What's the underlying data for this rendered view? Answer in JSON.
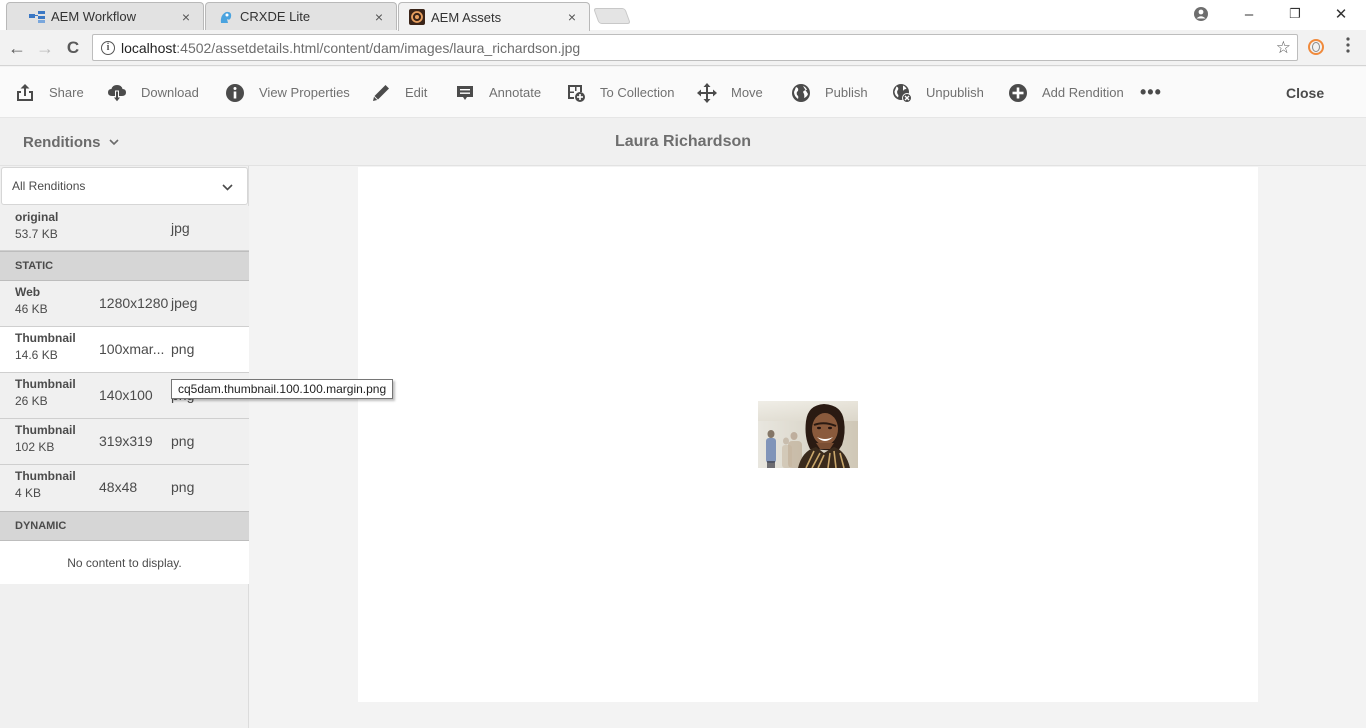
{
  "browser": {
    "tabs": [
      {
        "title": "AEM Workflow",
        "icon": "workflow-icon",
        "active": false
      },
      {
        "title": "CRXDE Lite",
        "icon": "crxde-icon",
        "active": false
      },
      {
        "title": "AEM Assets",
        "icon": "aem-icon",
        "active": true
      }
    ],
    "close_glyph": "×",
    "window_controls": {
      "profile": "profile-icon",
      "minimize": "–",
      "restore": "❐",
      "close": "✕"
    },
    "nav": {
      "back": "←",
      "forward": "→",
      "reload": "C"
    },
    "url": {
      "host": "localhost",
      "path": ":4502/assetdetails.html/content/dam/images/laura_richardson.jpg"
    },
    "star": "☆",
    "menu": "⋮"
  },
  "toolbar": {
    "actions": [
      {
        "label": "Share",
        "icon": "share-icon"
      },
      {
        "label": "Download",
        "icon": "download-icon"
      },
      {
        "label": "View Properties",
        "icon": "info-icon"
      },
      {
        "label": "Edit",
        "icon": "pencil-icon"
      },
      {
        "label": "Annotate",
        "icon": "annotate-icon"
      },
      {
        "label": "To Collection",
        "icon": "collection-add-icon"
      },
      {
        "label": "Move",
        "icon": "move-icon"
      },
      {
        "label": "Publish",
        "icon": "globe-icon"
      },
      {
        "label": "Unpublish",
        "icon": "globe-remove-icon"
      },
      {
        "label": "Add Rendition",
        "icon": "add-circle-icon"
      }
    ],
    "more": "•••",
    "close_label": "Close"
  },
  "header": {
    "rail_label": "Renditions",
    "title": "Laura Richardson"
  },
  "rail": {
    "filter": {
      "selected": "All Renditions"
    },
    "original": {
      "name": "original",
      "size": "53.7 KB",
      "dimensions": "",
      "type": "jpg"
    },
    "sections": [
      {
        "title": "STATIC",
        "items": [
          {
            "name": "Web",
            "size": "46 KB",
            "dimensions": "1280x1280",
            "type": "jpeg",
            "selected": false
          },
          {
            "name": "Thumbnail",
            "size": "14.6 KB",
            "dimensions": "100xmar...",
            "type": "png",
            "selected": true
          },
          {
            "name": "Thumbnail",
            "size": "26 KB",
            "dimensions": "140x100",
            "type": "png",
            "selected": false
          },
          {
            "name": "Thumbnail",
            "size": "102 KB",
            "dimensions": "319x319",
            "type": "png",
            "selected": false
          },
          {
            "name": "Thumbnail",
            "size": "4 KB",
            "dimensions": "48x48",
            "type": "png",
            "selected": false
          }
        ]
      },
      {
        "title": "DYNAMIC",
        "empty_text": "No content to display."
      }
    ],
    "tooltip": "cq5dam.thumbnail.100.100.margin.png"
  },
  "preview": {
    "alt": "Smiling woman in striped top, blurred office background"
  }
}
